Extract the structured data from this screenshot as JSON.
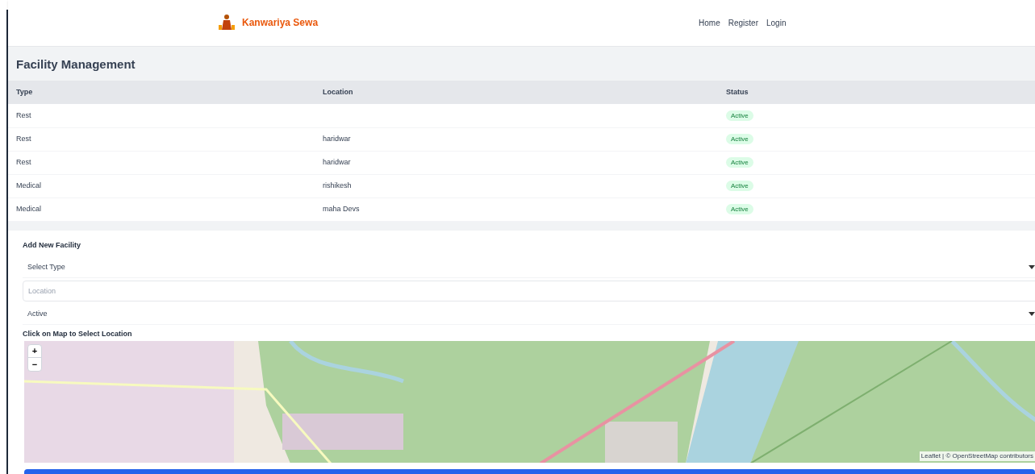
{
  "header": {
    "brand": "Kanwariya Sewa",
    "nav": [
      {
        "label": "Home"
      },
      {
        "label": "Register"
      },
      {
        "label": "Login"
      }
    ]
  },
  "page_title": "Facility Management",
  "table": {
    "columns": [
      "Type",
      "Location",
      "Status"
    ],
    "rows": [
      {
        "type": "Rest",
        "location": "",
        "status": "Active"
      },
      {
        "type": "Rest",
        "location": "haridwar",
        "status": "Active"
      },
      {
        "type": "Rest",
        "location": "haridwar",
        "status": "Active"
      },
      {
        "type": "Medical",
        "location": "rishikesh",
        "status": "Active"
      },
      {
        "type": "Medical",
        "location": "maha Devs",
        "status": "Active"
      }
    ]
  },
  "form": {
    "title": "Add New Facility",
    "type_select": {
      "value": "Select Type"
    },
    "location_field": {
      "placeholder": "Location"
    },
    "status_select": {
      "value": "Active"
    },
    "map_label": "Click on Map to Select Location",
    "map": {
      "zoom_in": "+",
      "zoom_out": "−",
      "attribution": "Leaflet | © OpenStreetMap contributors"
    }
  }
}
